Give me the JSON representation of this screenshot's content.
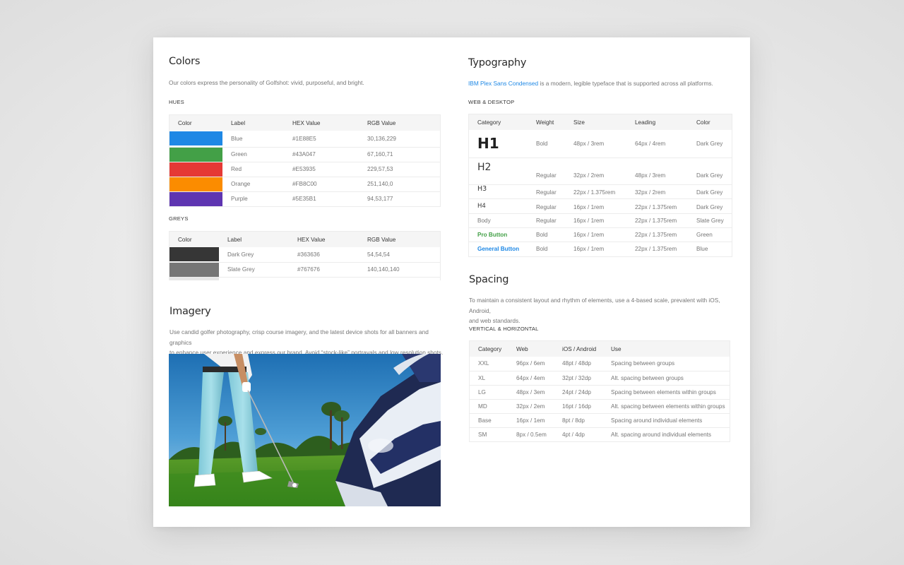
{
  "colors": {
    "title": "Colors",
    "description": "Our colors express the personality of Golfshot: vivid, purposeful, and bright.",
    "hues_heading": "HUES",
    "columns": [
      "Color",
      "Label",
      "HEX Value",
      "RGB Value"
    ],
    "hues": [
      {
        "label": "Blue",
        "hex": "#1E88E5",
        "rgb": "30,136,229"
      },
      {
        "label": "Green",
        "hex": "#43A047",
        "rgb": "67,160,71"
      },
      {
        "label": "Red",
        "hex": "#E53935",
        "rgb": "229,57,53"
      },
      {
        "label": "Orange",
        "hex": "#FB8C00",
        "rgb": "251,140,0"
      },
      {
        "label": "Purple",
        "hex": "#5E35B1",
        "rgb": "94,53,177"
      }
    ],
    "greys_heading": "GREYS",
    "greys": [
      {
        "label": "Dark Grey",
        "hex": "#363636",
        "rgb": "54,54,54"
      },
      {
        "label": "Slate Grey",
        "hex": "#767676",
        "rgb": "140,140,140"
      }
    ]
  },
  "imagery": {
    "title": "Imagery",
    "description_line1": "Use candid golfer photography, crisp course imagery, and the latest device shots for all banners and graphics",
    "description_line2": "to enhance user experience and express our brand. Avoid “stock-like” portrayals and low resolution shots."
  },
  "typography": {
    "title": "Typography",
    "font_link": "IBM Plex Sans Condensed",
    "description_rest": " is a modern, legible typeface that is supported across all platforms.",
    "web_heading": "WEB & DESKTOP",
    "columns": [
      "Category",
      "Weight",
      "Size",
      "Leading",
      "Color"
    ],
    "rows": [
      {
        "category": "H1",
        "weight": "Bold",
        "size": "48px / 3rem",
        "leading": "64px / 4rem",
        "color": "Dark Grey"
      },
      {
        "category": "H2",
        "weight": "Regular",
        "size": "32px / 2rem",
        "leading": "48px / 3rem",
        "color": "Dark Grey"
      },
      {
        "category": "H3",
        "weight": "Regular",
        "size": "22px / 1.375rem",
        "leading": "32px / 2rem",
        "color": "Dark Grey"
      },
      {
        "category": "H4",
        "weight": "Regular",
        "size": "16px / 1rem",
        "leading": "22px / 1.375rem",
        "color": "Dark Grey"
      },
      {
        "category": "Body",
        "weight": "Regular",
        "size": "16px / 1rem",
        "leading": "22px / 1.375rem",
        "color": "Slate Grey"
      },
      {
        "category": "Pro Button",
        "weight": "Bold",
        "size": "16px / 1rem",
        "leading": "22px / 1.375rem",
        "color": "Green"
      },
      {
        "category": "General Button",
        "weight": "Bold",
        "size": "16px / 1rem",
        "leading": "22px / 1.375rem",
        "color": "Blue"
      }
    ]
  },
  "spacing": {
    "title": "Spacing",
    "description_line1": "To maintain a consistent layout and rhythm of elements, use a 4-based scale, prevalent with iOS, Android,",
    "description_line2": "and web standards.",
    "heading": "VERTICAL & HORIZONTAL",
    "columns": [
      "Category",
      "Web",
      "iOS / Android",
      "Use"
    ],
    "rows": [
      {
        "category": "XXL",
        "web": "96px / 6em",
        "ios": "48pt / 48dp",
        "use": "Spacing between groups"
      },
      {
        "category": "XL",
        "web": "64px / 4em",
        "ios": "32pt / 32dp",
        "use": "Alt. spacing between groups"
      },
      {
        "category": "LG",
        "web": "48px / 3em",
        "ios": "24pt / 24dp",
        "use": "Spacing between elements within groups"
      },
      {
        "category": "MD",
        "web": "32px / 2em",
        "ios": "16pt / 16dp",
        "use": "Alt. spacing between elements within groups"
      },
      {
        "category": "Base",
        "web": "16px / 1em",
        "ios": "8pt / 8dp",
        "use": "Spacing around individual elements"
      },
      {
        "category": "SM",
        "web": "8px / 0.5em",
        "ios": "4pt / 4dp",
        "use": "Alt. spacing around individual elements"
      }
    ]
  }
}
